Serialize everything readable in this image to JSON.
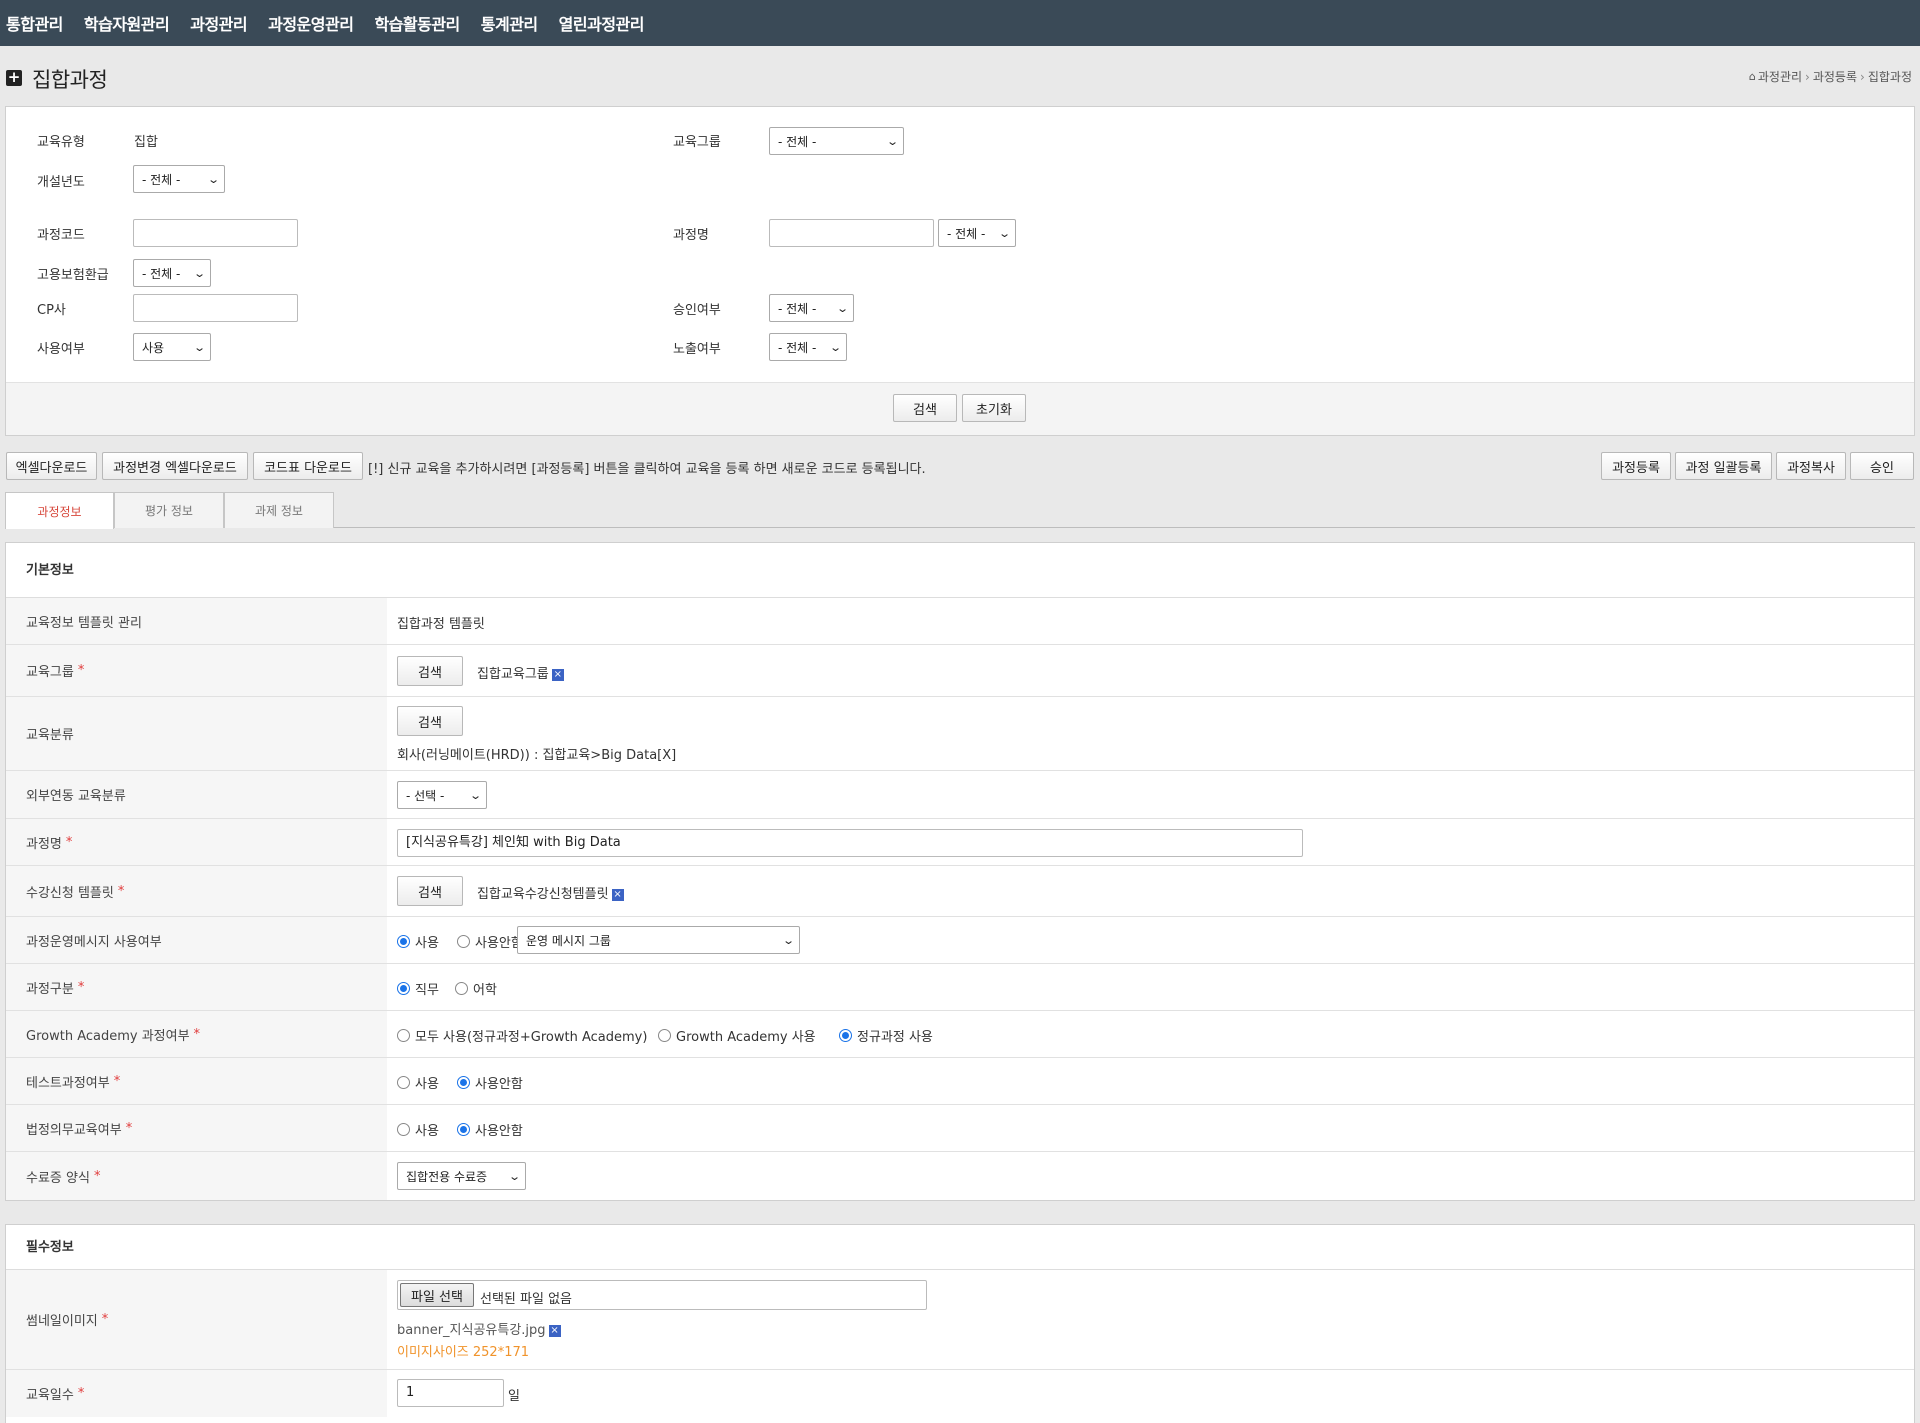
{
  "nav": [
    "통합관리",
    "학습자원관리",
    "과정관리",
    "과정운영관리",
    "학습활동관리",
    "통계관리",
    "열린과정관리"
  ],
  "title": "집합과정",
  "breadcrumb": [
    "과정관리",
    "과정등록",
    "집합과정"
  ],
  "search": {
    "edu_type_label": "교육유형",
    "edu_type_value": "집합",
    "edu_group_label": "교육그룹",
    "edu_group_value": "- 전체 -",
    "year_label": "개설년도",
    "year_value": "- 전체 -",
    "code_label": "과정코드",
    "code_value": "",
    "name_label": "과정명",
    "name_value": "",
    "name_filter_value": "- 전체 -",
    "insurance_label": "고용보험환급",
    "insurance_value": "- 전체 -",
    "cp_label": "CP사",
    "cp_value": "",
    "approval_label": "승인여부",
    "approval_value": "- 전체 -",
    "use_label": "사용여부",
    "use_value": "사용",
    "exposure_label": "노출여부",
    "exposure_value": "- 전체 -",
    "search_btn": "검색",
    "reset_btn": "초기화"
  },
  "toolbar": {
    "excel_download": "엑셀다운로드",
    "change_excel_download": "과정변경 엑셀다운로드",
    "code_download": "코드표 다운로드",
    "notice": "[!] 신규 교육을 추가하시려면 [과정등록] 버튼을 클릭하여 교육을 등록 하면 새로운 코드로 등록됩니다.",
    "register": "과정등록",
    "bulk_register": "과정 일괄등록",
    "copy": "과정복사",
    "approve": "승인"
  },
  "tabs": [
    "과정정보",
    "평가 정보",
    "과제 정보"
  ],
  "basic": {
    "heading": "기본정보",
    "template_label": "교육정보 템플릿 관리",
    "template_value": "집합과정 템플릿",
    "group_label": "교육그룹",
    "group_search": "검색",
    "group_value": "집합교육그룹",
    "category_label": "교육분류",
    "category_search": "검색",
    "category_value": "회사(러닝메이트(HRD)) : 집합교육>Big Data[X]",
    "ext_category_label": "외부연동 교육분류",
    "ext_category_value": "- 선택 -",
    "course_name_label": "과정명",
    "course_name_value": "[지식공유특강] 체인知 with Big Data",
    "apply_template_label": "수강신청 템플릿",
    "apply_template_search": "검색",
    "apply_template_value": "집합교육수강신청템플릿",
    "op_message_label": "과정운영메시지 사용여부",
    "op_message_use": "사용",
    "op_message_nouse": "사용안함",
    "op_message_group": "운영 메시지 그룹",
    "course_type_label": "과정구분",
    "course_type_job": "직무",
    "course_type_lang": "어학",
    "growth_label": "Growth Academy 과정여부",
    "growth_all": "모두 사용(정규과정+Growth Academy)",
    "growth_ga": "Growth Academy 사용",
    "growth_regular": "정규과정 사용",
    "test_label": "테스트과정여부",
    "test_use": "사용",
    "test_nouse": "사용안함",
    "legal_label": "법정의무교육여부",
    "legal_use": "사용",
    "legal_nouse": "사용안함",
    "cert_label": "수료증 양식",
    "cert_value": "집합전용 수료증"
  },
  "required": {
    "heading": "필수정보",
    "thumb_label": "썸네일이미지",
    "file_btn": "파일 선택",
    "file_status": "선택된 파일 없음",
    "file_name": "banner_지식공유특강.jpg",
    "image_size": "이미지사이즈 252*171",
    "days_label": "교육일수",
    "days_value": "1",
    "days_unit": "일"
  },
  "colors": {
    "nav_bg": "#3a4a57",
    "active_tab": "#d7473b",
    "required_mark": "#e03b3b",
    "hint_orange": "#f0932b",
    "radio_blue": "#1a73e8"
  }
}
